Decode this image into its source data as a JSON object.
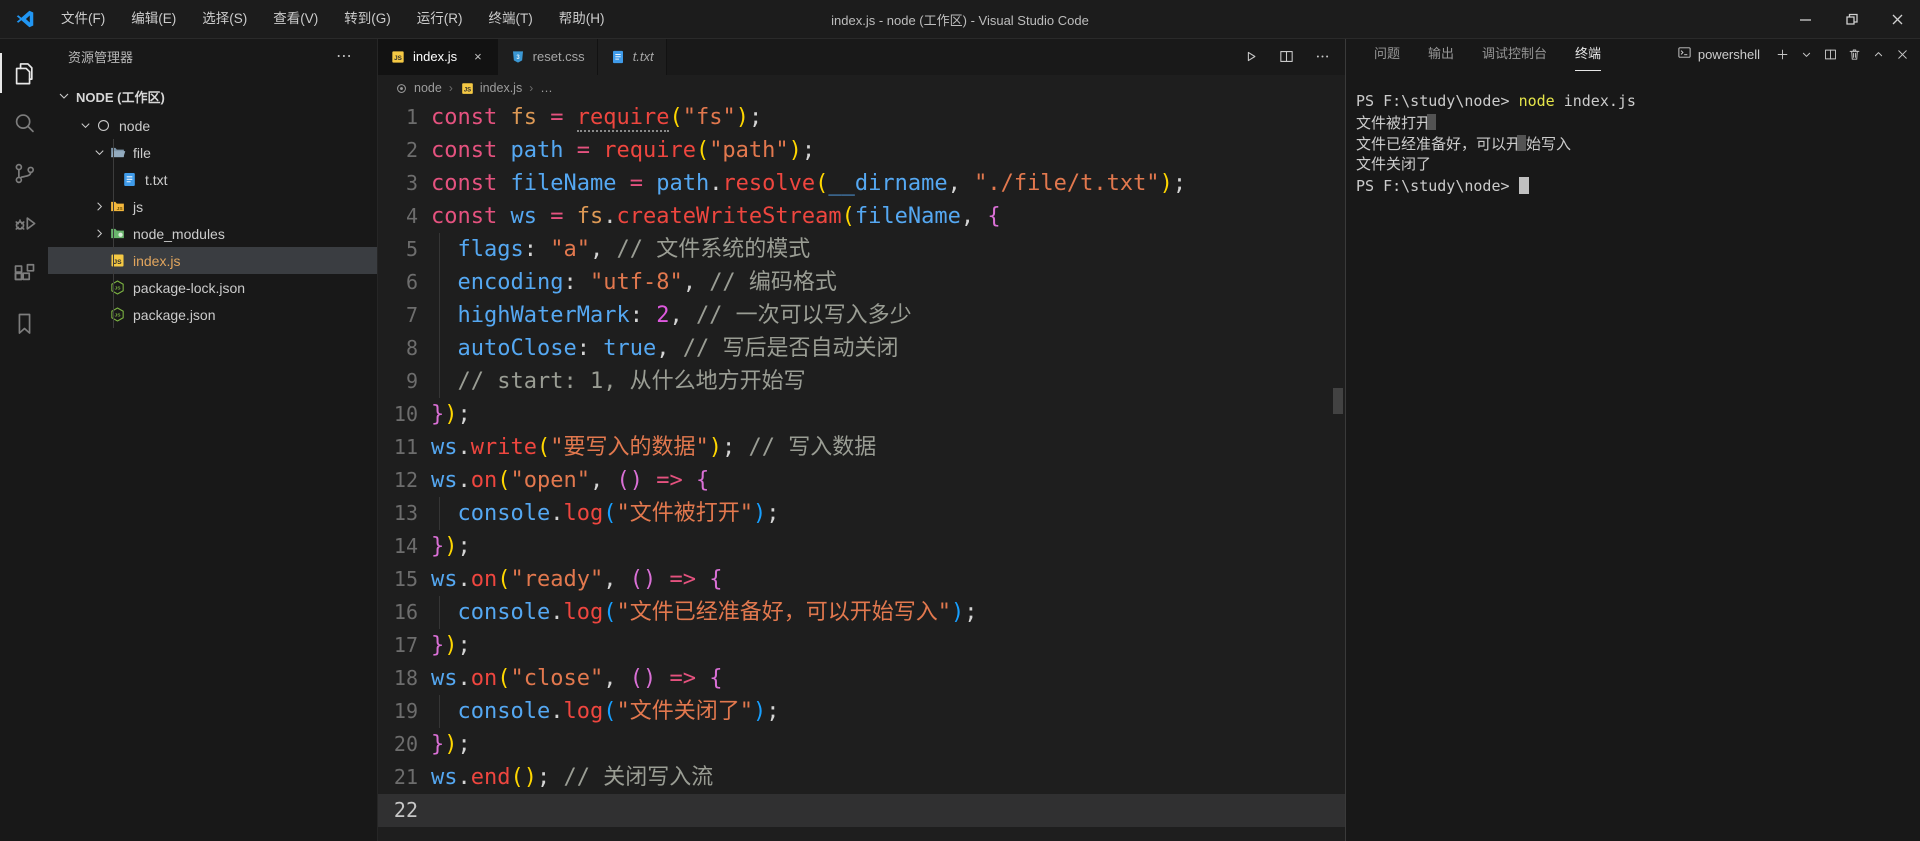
{
  "window": {
    "title": "index.js - node (工作区) - Visual Studio Code",
    "menus": [
      "文件(F)",
      "编辑(E)",
      "选择(S)",
      "查看(V)",
      "转到(G)",
      "运行(R)",
      "终端(T)",
      "帮助(H)"
    ],
    "controls": [
      "minimize",
      "restore",
      "close"
    ]
  },
  "activity_bar": {
    "items": [
      {
        "name": "explorer",
        "active": true
      },
      {
        "name": "search",
        "active": false
      },
      {
        "name": "source-control",
        "active": false
      },
      {
        "name": "run-debug",
        "active": false
      },
      {
        "name": "extensions",
        "active": false
      },
      {
        "name": "bookmarks",
        "active": false
      }
    ]
  },
  "sidebar": {
    "title": "资源管理器",
    "more_label": "⋯",
    "root": "NODE (工作区)",
    "tree": [
      {
        "label": "node",
        "icon": "folder-root",
        "level": 1,
        "chevron": "down"
      },
      {
        "label": "file",
        "icon": "folder-open",
        "level": 2,
        "chevron": "down"
      },
      {
        "label": "t.txt",
        "icon": "file-text",
        "level": 3
      },
      {
        "label": "js",
        "icon": "folder-js",
        "level": 2,
        "chevron": "right"
      },
      {
        "label": "node_modules",
        "icon": "folder-node-modules",
        "level": 2,
        "chevron": "right"
      },
      {
        "label": "index.js",
        "icon": "file-js",
        "level": 2,
        "selected": true,
        "modified": true
      },
      {
        "label": "package-lock.json",
        "icon": "file-node",
        "level": 2
      },
      {
        "label": "package.json",
        "icon": "file-node",
        "level": 2
      }
    ]
  },
  "editor": {
    "tabs": [
      {
        "label": "index.js",
        "icon": "file-js",
        "active": true,
        "close": "×"
      },
      {
        "label": "reset.css",
        "icon": "file-css"
      },
      {
        "label": "t.txt",
        "icon": "file-text",
        "italic": true
      }
    ],
    "actions": [
      "run",
      "split-editor",
      "more"
    ],
    "breadcrumb": [
      {
        "label": "node",
        "icon": "symbol-module"
      },
      {
        "label": "index.js",
        "icon": "file-js"
      },
      {
        "label": "…"
      }
    ],
    "current_line": 22,
    "lines": [
      {
        "n": 1,
        "seg": [
          [
            "const ",
            "k"
          ],
          [
            "fs ",
            "mod"
          ],
          [
            "= ",
            "k"
          ],
          [
            "require",
            "fn hint"
          ],
          [
            "(",
            "b1"
          ],
          [
            "\"fs\"",
            "s"
          ],
          [
            ")",
            "b1"
          ],
          [
            ";",
            "p"
          ]
        ]
      },
      {
        "n": 2,
        "seg": [
          [
            "const ",
            "k"
          ],
          [
            "path ",
            "v"
          ],
          [
            "= ",
            "k"
          ],
          [
            "require",
            "fn"
          ],
          [
            "(",
            "b1"
          ],
          [
            "\"path\"",
            "s"
          ],
          [
            ")",
            "b1"
          ],
          [
            ";",
            "p"
          ]
        ]
      },
      {
        "n": 3,
        "seg": [
          [
            "const ",
            "k"
          ],
          [
            "fileName ",
            "v"
          ],
          [
            "= ",
            "k"
          ],
          [
            "path",
            "v"
          ],
          [
            ".",
            "p"
          ],
          [
            "resolve",
            "fn"
          ],
          [
            "(",
            "b1"
          ],
          [
            "__dirname",
            "v"
          ],
          [
            ", ",
            "p"
          ],
          [
            "\"./file/t.txt\"",
            "s"
          ],
          [
            ")",
            "b1"
          ],
          [
            ";",
            "p"
          ]
        ]
      },
      {
        "n": 4,
        "seg": [
          [
            "const ",
            "k"
          ],
          [
            "ws ",
            "v"
          ],
          [
            "= ",
            "k"
          ],
          [
            "fs",
            "mod"
          ],
          [
            ".",
            "p"
          ],
          [
            "createWriteStream",
            "fn"
          ],
          [
            "(",
            "b1"
          ],
          [
            "fileName",
            "v"
          ],
          [
            ", ",
            "p"
          ],
          [
            "{",
            "b2"
          ]
        ]
      },
      {
        "n": 5,
        "g": true,
        "seg": [
          [
            "  ",
            "p"
          ],
          [
            "flags",
            "v"
          ],
          [
            ": ",
            "p"
          ],
          [
            "\"a\"",
            "s"
          ],
          [
            ", ",
            "p"
          ],
          [
            "// 文件系统的模式",
            "c"
          ]
        ]
      },
      {
        "n": 6,
        "g": true,
        "seg": [
          [
            "  ",
            "p"
          ],
          [
            "encoding",
            "v"
          ],
          [
            ": ",
            "p"
          ],
          [
            "\"utf-8\"",
            "s"
          ],
          [
            ", ",
            "p"
          ],
          [
            "// 编码格式",
            "c"
          ]
        ]
      },
      {
        "n": 7,
        "g": true,
        "seg": [
          [
            "  ",
            "p"
          ],
          [
            "highWaterMark",
            "v"
          ],
          [
            ": ",
            "p"
          ],
          [
            "2",
            "n"
          ],
          [
            ", ",
            "p"
          ],
          [
            "// 一次可以写入多少",
            "c"
          ]
        ]
      },
      {
        "n": 8,
        "g": true,
        "seg": [
          [
            "  ",
            "p"
          ],
          [
            "autoClose",
            "v"
          ],
          [
            ": ",
            "p"
          ],
          [
            "true",
            "b"
          ],
          [
            ", ",
            "p"
          ],
          [
            "// 写后是否自动关闭",
            "c"
          ]
        ]
      },
      {
        "n": 9,
        "g": true,
        "seg": [
          [
            "  ",
            "p"
          ],
          [
            "// start: 1, 从什么地方开始写",
            "c"
          ]
        ]
      },
      {
        "n": 10,
        "seg": [
          [
            "}",
            "b2"
          ],
          [
            ")",
            "b1"
          ],
          [
            ";",
            "p"
          ]
        ]
      },
      {
        "n": 11,
        "seg": [
          [
            "ws",
            "v"
          ],
          [
            ".",
            "p"
          ],
          [
            "write",
            "fn"
          ],
          [
            "(",
            "b1"
          ],
          [
            "\"要写入的数据\"",
            "s"
          ],
          [
            ")",
            "b1"
          ],
          [
            "; ",
            "p"
          ],
          [
            "// 写入数据",
            "c"
          ]
        ]
      },
      {
        "n": 12,
        "seg": [
          [
            "ws",
            "v"
          ],
          [
            ".",
            "p"
          ],
          [
            "on",
            "fn"
          ],
          [
            "(",
            "b1"
          ],
          [
            "\"open\"",
            "s"
          ],
          [
            ", ",
            "p"
          ],
          [
            "()",
            "b2"
          ],
          [
            " => ",
            "k"
          ],
          [
            "{",
            "b2"
          ]
        ]
      },
      {
        "n": 13,
        "g": true,
        "seg": [
          [
            "  ",
            "p"
          ],
          [
            "console",
            "v"
          ],
          [
            ".",
            "p"
          ],
          [
            "log",
            "fn"
          ],
          [
            "(",
            "b3"
          ],
          [
            "\"文件被打开\"",
            "s"
          ],
          [
            ")",
            "b3"
          ],
          [
            ";",
            "p"
          ]
        ]
      },
      {
        "n": 14,
        "seg": [
          [
            "}",
            "b2"
          ],
          [
            ")",
            "b1"
          ],
          [
            ";",
            "p"
          ]
        ]
      },
      {
        "n": 15,
        "seg": [
          [
            "ws",
            "v"
          ],
          [
            ".",
            "p"
          ],
          [
            "on",
            "fn"
          ],
          [
            "(",
            "b1"
          ],
          [
            "\"ready\"",
            "s"
          ],
          [
            ", ",
            "p"
          ],
          [
            "()",
            "b2"
          ],
          [
            " => ",
            "k"
          ],
          [
            "{",
            "b2"
          ]
        ]
      },
      {
        "n": 16,
        "g": true,
        "seg": [
          [
            "  ",
            "p"
          ],
          [
            "console",
            "v"
          ],
          [
            ".",
            "p"
          ],
          [
            "log",
            "fn"
          ],
          [
            "(",
            "b3"
          ],
          [
            "\"文件已经准备好，可以开始写入\"",
            "s"
          ],
          [
            ")",
            "b3"
          ],
          [
            ";",
            "p"
          ]
        ]
      },
      {
        "n": 17,
        "seg": [
          [
            "}",
            "b2"
          ],
          [
            ")",
            "b1"
          ],
          [
            ";",
            "p"
          ]
        ]
      },
      {
        "n": 18,
        "seg": [
          [
            "ws",
            "v"
          ],
          [
            ".",
            "p"
          ],
          [
            "on",
            "fn"
          ],
          [
            "(",
            "b1"
          ],
          [
            "\"close\"",
            "s"
          ],
          [
            ", ",
            "p"
          ],
          [
            "()",
            "b2"
          ],
          [
            " => ",
            "k"
          ],
          [
            "{",
            "b2"
          ]
        ]
      },
      {
        "n": 19,
        "g": true,
        "seg": [
          [
            "  ",
            "p"
          ],
          [
            "console",
            "v"
          ],
          [
            ".",
            "p"
          ],
          [
            "log",
            "fn"
          ],
          [
            "(",
            "b3"
          ],
          [
            "\"文件关闭了\"",
            "s"
          ],
          [
            ")",
            "b3"
          ],
          [
            ";",
            "p"
          ]
        ]
      },
      {
        "n": 20,
        "seg": [
          [
            "}",
            "b2"
          ],
          [
            ")",
            "b1"
          ],
          [
            ";",
            "p"
          ]
        ]
      },
      {
        "n": 21,
        "seg": [
          [
            "ws",
            "v"
          ],
          [
            ".",
            "p"
          ],
          [
            "end",
            "fn"
          ],
          [
            "()",
            "b1"
          ],
          [
            "; ",
            "p"
          ],
          [
            "// 关闭写入流",
            "c"
          ]
        ]
      },
      {
        "n": 22,
        "seg": []
      }
    ]
  },
  "panel": {
    "tabs": [
      {
        "label": "问题"
      },
      {
        "label": "输出"
      },
      {
        "label": "调试控制台"
      },
      {
        "label": "终端",
        "active": true
      }
    ],
    "shell": {
      "icon": "terminal",
      "label": "powershell"
    },
    "actions": [
      "new-terminal",
      "launch-profile-dropdown",
      "split-terminal",
      "kill-terminal",
      "maximize-panel",
      "close-panel"
    ],
    "lines": [
      [
        [
          "PS F:\\study\\node> ",
          "t"
        ],
        [
          "node",
          "y"
        ],
        [
          " index.js",
          "t"
        ]
      ],
      [
        [
          "文件被打开",
          "t"
        ],
        [
          "",
          "ghost"
        ]
      ],
      [
        [
          "文件已经准备好，可以开",
          "t"
        ],
        [
          "",
          "ghost"
        ],
        [
          "始写入",
          "t"
        ]
      ],
      [
        [
          "文件关闭了",
          "t"
        ]
      ],
      [
        [
          "PS F:\\study\\node> ",
          "t"
        ],
        [
          "",
          "cursor"
        ]
      ]
    ]
  },
  "colors": {
    "titlebar_bg": "#1c1c1c",
    "sidebar_bg": "#181818",
    "editor_bg": "#1e1e1e",
    "panel_bg": "#181818",
    "keyword": "#e5527f",
    "variable": "#55a8f2",
    "function_call": "#ee463f",
    "string": "#e2784e",
    "number": "#df59df",
    "comment": "#9a9d94",
    "bracket1": "#ffd700",
    "bracket2": "#da70d6",
    "bracket3": "#179fff",
    "modified_file": "#e2a65e",
    "terminal_command": "#e5e54a"
  }
}
